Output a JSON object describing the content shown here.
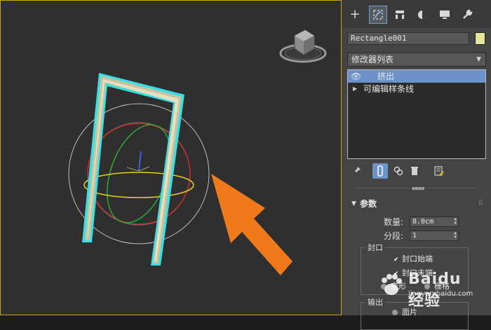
{
  "command_panel": {
    "tabs": [
      {
        "icon": "create-plus-icon",
        "glyph": "+"
      },
      {
        "icon": "modify-icon",
        "glyph": "⌜"
      },
      {
        "icon": "hierarchy-icon",
        "glyph": "⊓"
      },
      {
        "icon": "motion-icon",
        "glyph": "◑"
      },
      {
        "icon": "display-icon",
        "glyph": "▬"
      },
      {
        "icon": "utilities-wrench-icon",
        "glyph": "✎"
      }
    ],
    "object_name": "Rectangle001",
    "object_color": "#e6e69a",
    "modifier_list_label": "修改器列表",
    "stack": [
      {
        "label": "挤出",
        "selected": true
      },
      {
        "label": "可编辑样条线",
        "selected": false
      }
    ],
    "stack_toolbar": [
      "pin-stack-icon",
      "show-end-result-icon",
      "make-unique-icon",
      "remove-modifier-icon",
      "configure-sets-icon"
    ],
    "parameters": {
      "rollout_title": "参数",
      "amount_label": "数量:",
      "amount_value": "8.0cm",
      "segments_label": "分段:",
      "segments_value": "1",
      "capping_group": "封口",
      "cap_start_label": "封口始端",
      "cap_end_label": "封口末端",
      "morph_label": "变形",
      "grid_label": "栅格",
      "output_group": "输出",
      "patch_label": "面片"
    }
  },
  "watermark": {
    "brand": "Baidu 经验",
    "url": "jingyan.baidu.com"
  },
  "colors": {
    "viewport_border": "#c9a227",
    "selection_cyan": "#35e0e6",
    "arrow_orange": "#f07a1a",
    "selected_row": "#6d92c9"
  }
}
